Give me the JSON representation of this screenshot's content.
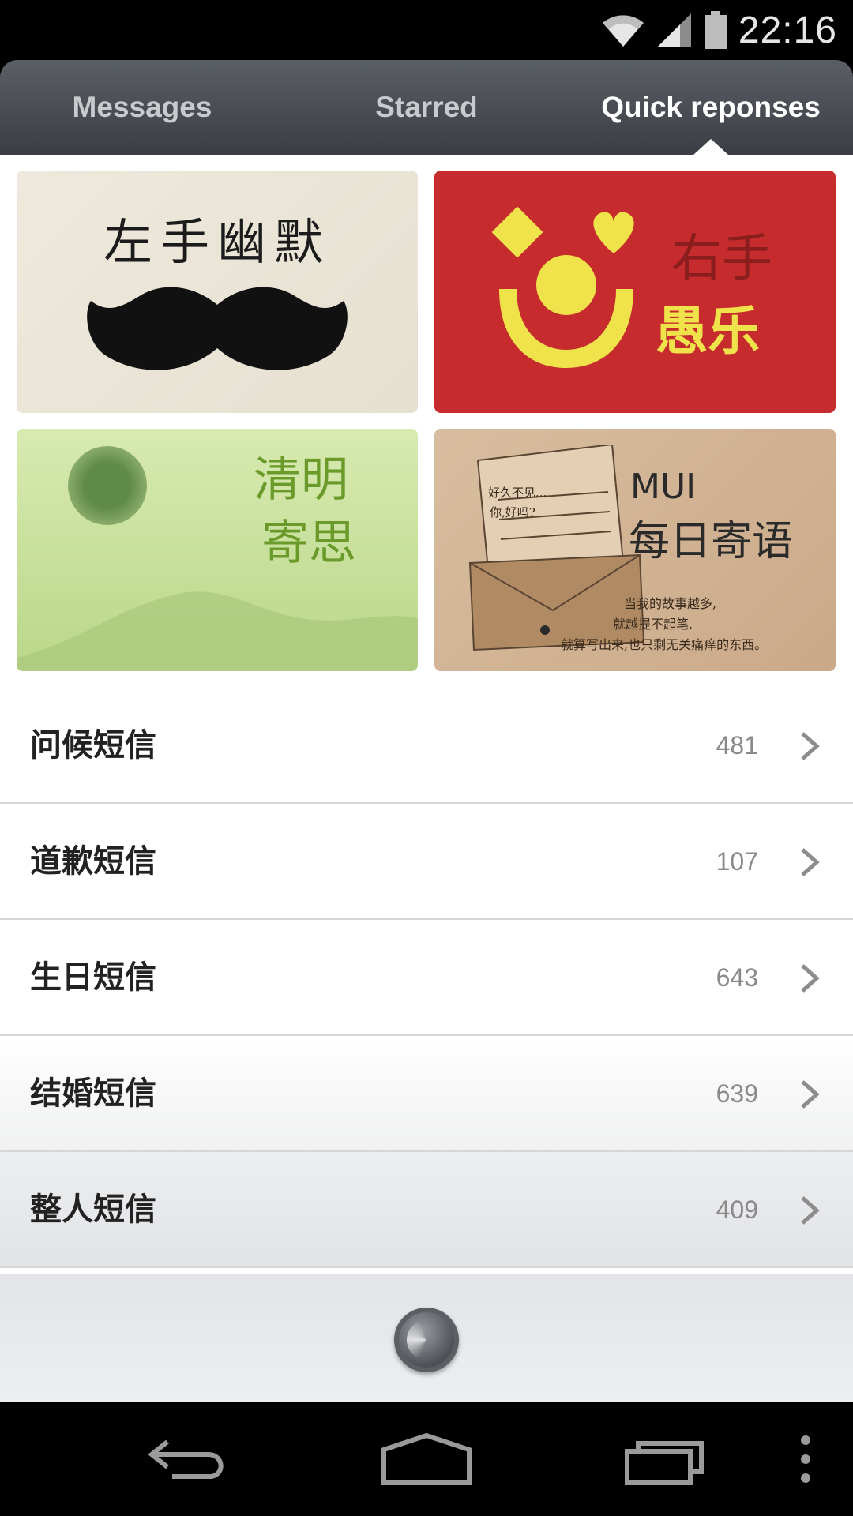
{
  "status_bar": {
    "time": "22:16",
    "icons": [
      "wifi-icon",
      "signal-icon",
      "battery-icon"
    ]
  },
  "tabs": [
    {
      "label": "Messages",
      "active": false
    },
    {
      "label": "Starred",
      "active": false
    },
    {
      "label": "Quick reponses",
      "active": true
    }
  ],
  "banners": [
    {
      "title": "左手幽默",
      "color": "#ebe6d8"
    },
    {
      "line1": "右手",
      "line2": "愚乐",
      "color": "#c62b2d"
    },
    {
      "line1": "清明",
      "line2": "寄思",
      "color": "#cfe3a2"
    },
    {
      "brand": "MUI",
      "title": "每日寄语",
      "note1": "当我的故事越多,",
      "note2": "就越提不起笔,",
      "note3": "就算写出来,也只剩无关痛痒的东西。",
      "letter1": "好久不见...",
      "letter2": "你,好吗?",
      "color": "#d3b697"
    }
  ],
  "categories": [
    {
      "label": "问候短信",
      "count": "481"
    },
    {
      "label": "道歉短信",
      "count": "107"
    },
    {
      "label": "生日短信",
      "count": "643"
    },
    {
      "label": "结婚短信",
      "count": "639"
    },
    {
      "label": "整人短信",
      "count": "409"
    }
  ],
  "nav_bar": {
    "buttons": [
      "back-icon",
      "home-icon",
      "recent-apps-icon",
      "overflow-menu-icon"
    ]
  },
  "colors": {
    "tab_bar": "#45484e",
    "accent_red": "#c62b2d",
    "accent_yellow": "#f0e24a",
    "green_text": "#6a9a2a"
  }
}
